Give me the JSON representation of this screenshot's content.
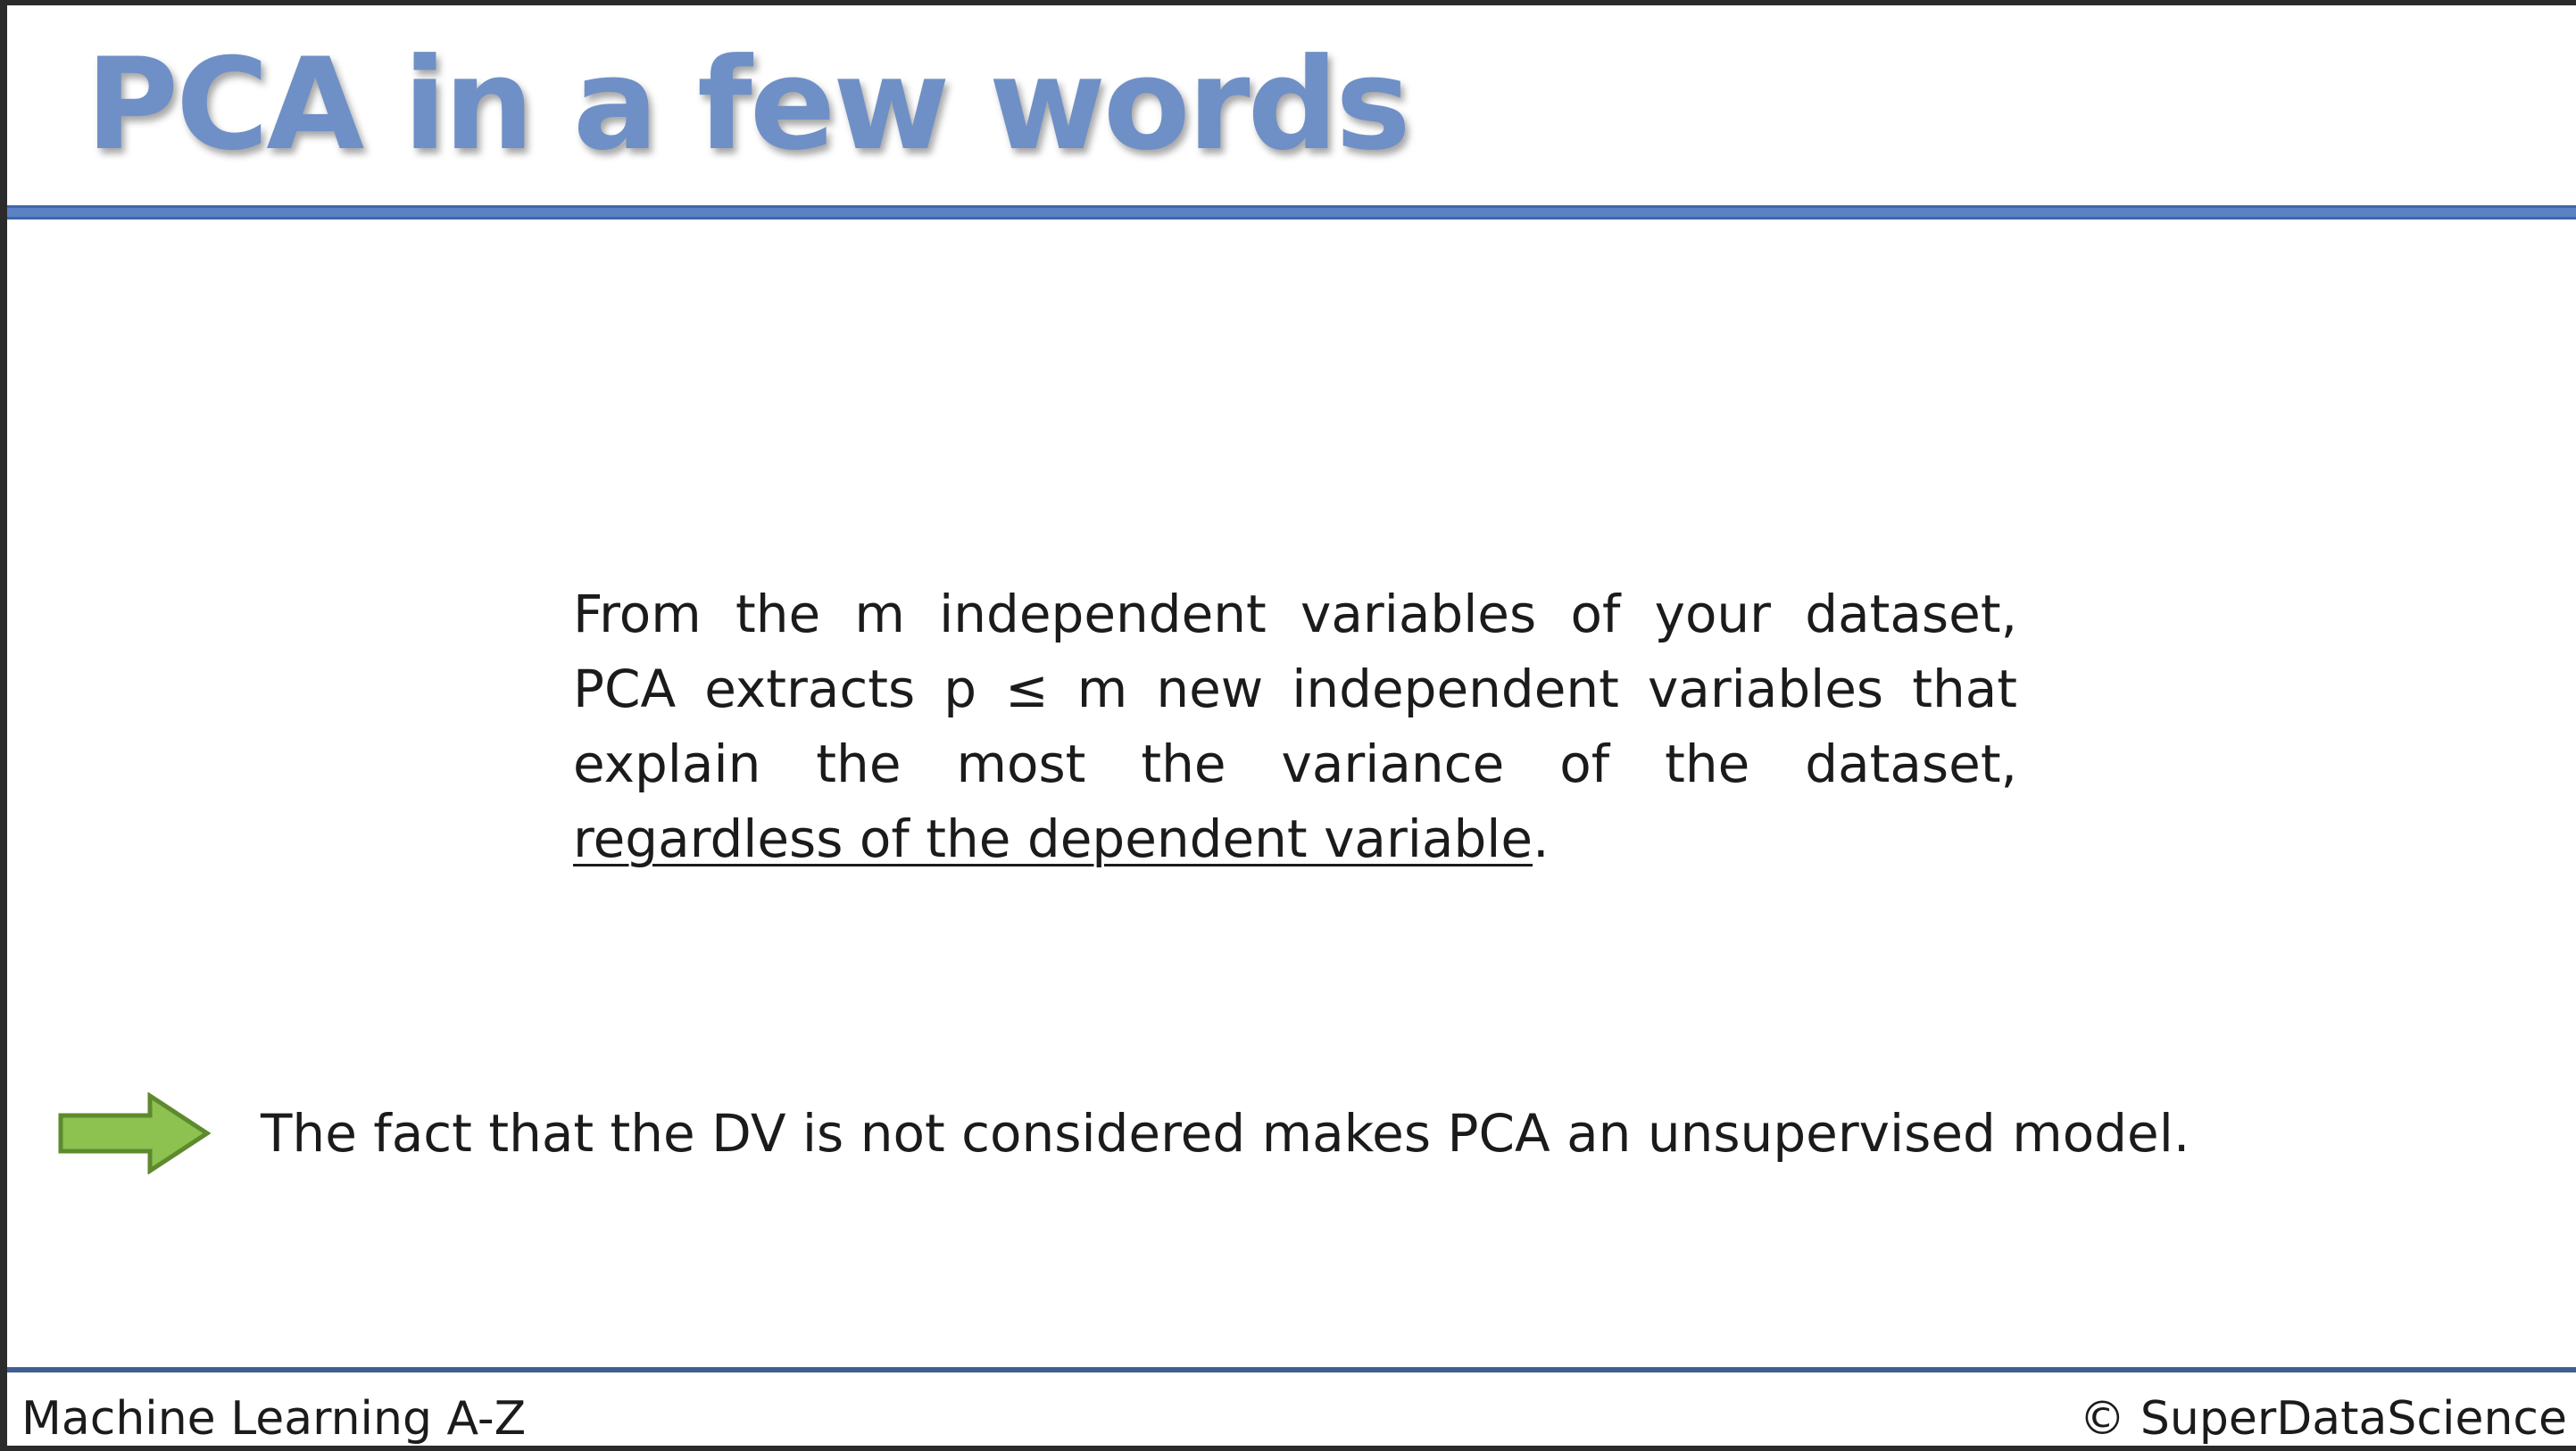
{
  "slide": {
    "title": "PCA in a few words",
    "body_lines": [
      "From the m independent variables of your dataset,",
      "PCA extracts p ≤ m new independent variables that",
      "explain the most the variance of the dataset,"
    ],
    "body_underlined": "regardless of the dependent variable",
    "body_end": ".",
    "conclusion": "The fact that the DV is not considered makes PCA an unsupervised model.",
    "conclusion_icon": "right-arrow-icon"
  },
  "footer": {
    "left": "Machine Learning A-Z",
    "right": "© SuperDataScience"
  },
  "colors": {
    "title": "#6f90c6",
    "rule": "#5b82c4",
    "footer_rule": "#3f5f92",
    "arrow_fill": "#8dc150",
    "arrow_stroke": "#5e8a2e"
  }
}
